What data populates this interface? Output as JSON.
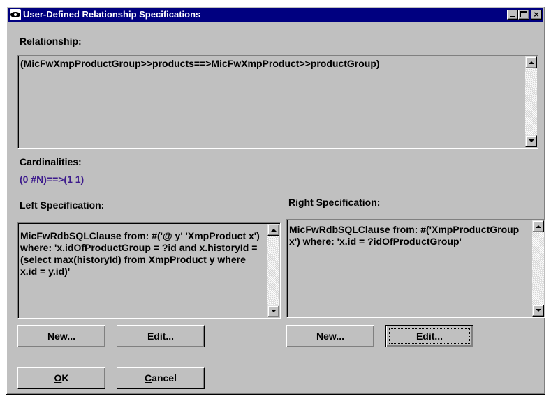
{
  "window": {
    "title": "User-Defined Relationship Specifications"
  },
  "relationship": {
    "label": "Relationship:",
    "value": "(MicFwXmpProductGroup>>products==>MicFwXmpProduct>>productGroup)"
  },
  "cardinalities": {
    "label": "Cardinalities:",
    "value": "(0 #N)==>(1 1)",
    "color": "#3c1a8c"
  },
  "left_spec": {
    "label": "Left Specification:",
    "value": "MicFwRdbSQLClause from: #('@ y' 'XmpProduct x') where: 'x.idOfProductGroup = ?id and x.historyId = (select max(historyId) from XmpProduct y where x.id = y.id)'",
    "new_label": "New...",
    "edit_label": "Edit..."
  },
  "right_spec": {
    "label": "Right Specification:",
    "value": "MicFwRdbSQLClause from: #('XmpProductGroup x') where: 'x.id = ?idOfProductGroup'",
    "new_label": "New...",
    "edit_label": "Edit..."
  },
  "dialog_buttons": {
    "ok_mnemonic": "O",
    "ok_rest": "K",
    "cancel_mnemonic": "C",
    "cancel_rest": "ancel"
  }
}
